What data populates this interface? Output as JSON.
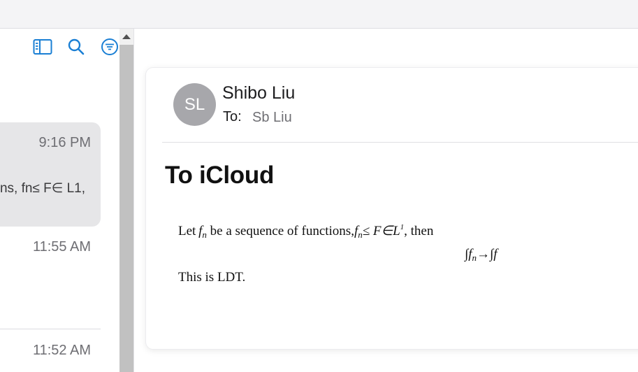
{
  "list": {
    "toolbar": [
      {
        "icon": "sidebar-toggle-icon"
      },
      {
        "icon": "search-icon"
      },
      {
        "icon": "filter-icon"
      }
    ],
    "messages": [
      {
        "time": "9:16 PM",
        "preview": "ns, fn≤ F∈ L1,",
        "selected": true
      },
      {
        "time": "11:55 AM"
      },
      {
        "time": "11:52 AM"
      }
    ]
  },
  "message": {
    "avatar_initials": "SL",
    "sender": "Shibo Liu",
    "to_label": "To:",
    "to_value": "Sb Liu",
    "subject": "To iCloud",
    "body": {
      "line1_let": "Let",
      "line1_f": "f",
      "line1_n": "n",
      "line1_mid": " be a sequence of functions,",
      "line1_f2": "f",
      "line1_n2": "n",
      "line1_rel": "≤ F∈L",
      "line1_sup": "1",
      "line1_end": ", then",
      "eq_int1": "∫",
      "eq_f": "f",
      "eq_n": "n",
      "eq_arrow": "→∫",
      "eq_f2": "f",
      "line2": "This is LDT."
    }
  },
  "colors": {
    "accent": "#1a7fd4",
    "avatar_bg": "#a7a7ab",
    "selected_row": "#e6e6e8",
    "scroll_thumb": "#c1c1c1"
  }
}
